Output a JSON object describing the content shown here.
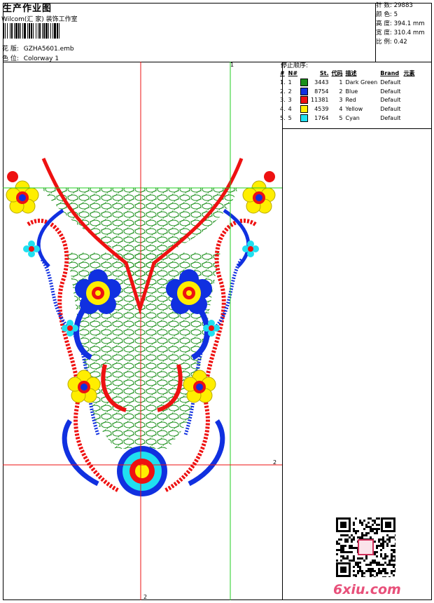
{
  "header": {
    "title": "生产作业图",
    "studio": "Wilcom(汇 家) 装饰工作室",
    "design_label": "花 版:",
    "design_file": "GZHA5601.emb",
    "colorway_label": "色 位:",
    "colorway": "Colorway 1"
  },
  "stats": [
    {
      "label": "针 数:",
      "value": "29883"
    },
    {
      "label": "颜 色:",
      "value": "5"
    },
    {
      "label": "高 度:",
      "value": "394.1 mm"
    },
    {
      "label": "宽 度:",
      "value": "310.4 mm"
    },
    {
      "label": "比 例:",
      "value": "0.42"
    }
  ],
  "stop_sequence": {
    "title": "停止顺序:",
    "columns": [
      "#",
      "N#",
      "St.",
      "代码",
      "描述",
      "Brand",
      "元素"
    ],
    "rows": [
      {
        "num": "1.",
        "needle": "1",
        "color": "#1a8f1a",
        "stitches": "3443",
        "code": "1",
        "desc": "Dark Green",
        "brand": "Default"
      },
      {
        "num": "2.",
        "needle": "2",
        "color": "#1030e0",
        "stitches": "8754",
        "code": "2",
        "desc": "Blue",
        "brand": "Default"
      },
      {
        "num": "3.",
        "needle": "3",
        "color": "#ee1111",
        "stitches": "11381",
        "code": "3",
        "desc": "Red",
        "brand": "Default"
      },
      {
        "num": "4.",
        "needle": "4",
        "color": "#ffee00",
        "stitches": "4539",
        "code": "4",
        "desc": "Yellow",
        "brand": "Default"
      },
      {
        "num": "5.",
        "needle": "5",
        "color": "#20e0f0",
        "stitches": "1764",
        "code": "5",
        "desc": "Cyan",
        "brand": "Default"
      }
    ]
  },
  "guides": {
    "top_label": "1",
    "right_label": "2",
    "bottom_label": "2"
  },
  "watermark": "6xiu.com"
}
